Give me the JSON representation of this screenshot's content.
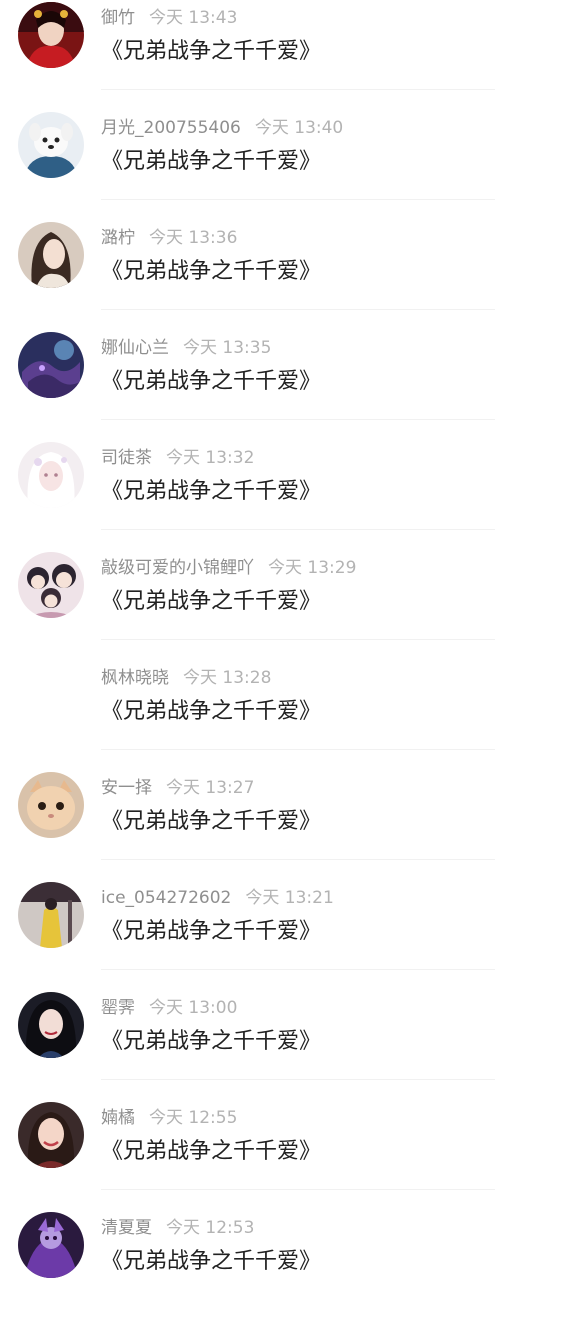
{
  "messages": [
    {
      "name": "御竹",
      "time": "今天 13:43",
      "text": "《兄弟战争之千千爱》",
      "avatar": "red-robed-woman-avatar"
    },
    {
      "name": "月光_200755406",
      "time": "今天 13:40",
      "text": "《兄弟战争之千千爱》",
      "avatar": "white-puppy-avatar"
    },
    {
      "name": "潞柠",
      "time": "今天 13:36",
      "text": "《兄弟战争之千千爱》",
      "avatar": "woman-portrait-avatar"
    },
    {
      "name": "娜仙心兰",
      "time": "今天 13:35",
      "text": "《兄弟战争之千千爱》",
      "avatar": "purple-dragon-avatar"
    },
    {
      "name": "司徒茶",
      "time": "今天 13:32",
      "text": "《兄弟战争之千千爱》",
      "avatar": "white-haired-girl-avatar"
    },
    {
      "name": "敲级可爱的小锦鲤吖",
      "time": "今天 13:29",
      "text": "《兄弟战争之千千爱》",
      "avatar": "chibi-group-avatar"
    },
    {
      "name": "枫林晓晓",
      "time": "今天 13:28",
      "text": "《兄弟战争之千千爱》",
      "avatar": "blank-avatar"
    },
    {
      "name": "安一择",
      "time": "今天 13:27",
      "text": "《兄弟战争之千千爱》",
      "avatar": "cat-avatar"
    },
    {
      "name": "ice_054272602",
      "time": "今天 13:21",
      "text": "《兄弟战争之千千爱》",
      "avatar": "yellow-dress-avatar"
    },
    {
      "name": "罂霁",
      "time": "今天 13:00",
      "text": "《兄弟战争之千千爱》",
      "avatar": "dark-hair-girl-avatar"
    },
    {
      "name": "婻橘",
      "time": "今天 12:55",
      "text": "《兄弟战争之千千爱》",
      "avatar": "smiling-woman-avatar"
    },
    {
      "name": "清夏夏",
      "time": "今天 12:53",
      "text": "《兄弟战争之千千爱》",
      "avatar": "purple-warrior-avatar"
    }
  ]
}
